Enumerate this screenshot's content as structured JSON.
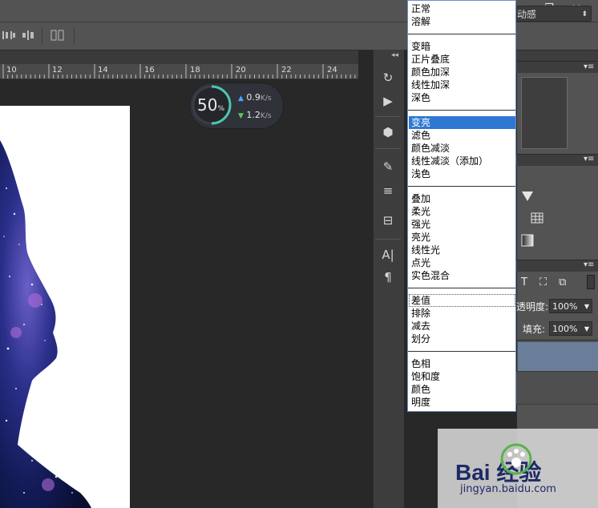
{
  "ruler": {
    "labels": [
      "10",
      "12",
      "14",
      "16",
      "18",
      "20",
      "22",
      "24"
    ]
  },
  "options": {
    "blend_value": "动感"
  },
  "speed_widget": {
    "percent": "50",
    "percent_unit": "%",
    "upload": "0.9",
    "upload_unit": "K/s",
    "download": "1.2",
    "download_unit": "K/s",
    "progress_fraction": 0.5
  },
  "blend_menu": {
    "groups": [
      [
        "正常",
        "溶解"
      ],
      [
        "变暗",
        "正片叠底",
        "颜色加深",
        "线性加深",
        "深色"
      ],
      [
        "变亮",
        "滤色",
        "颜色减淡",
        "线性减淡（添加）",
        "浅色"
      ],
      [
        "叠加",
        "柔光",
        "强光",
        "亮光",
        "线性光",
        "点光",
        "实色混合"
      ],
      [
        "差值",
        "排除",
        "减去",
        "划分"
      ],
      [
        "色相",
        "饱和度",
        "颜色",
        "明度"
      ]
    ],
    "selected": "变亮",
    "hovered": "差值"
  },
  "layers_panel": {
    "opacity_label": "透明度:",
    "opacity_value": "100%",
    "fill_label": "填充:",
    "fill_value": "100%"
  },
  "watermark": {
    "text": "Bai 经验",
    "subtext": "jingyan.baidu.com"
  },
  "colors": {
    "accent_selected": "#2f78d2",
    "panel_bg": "#535353",
    "canvas_bg": "#282828"
  }
}
